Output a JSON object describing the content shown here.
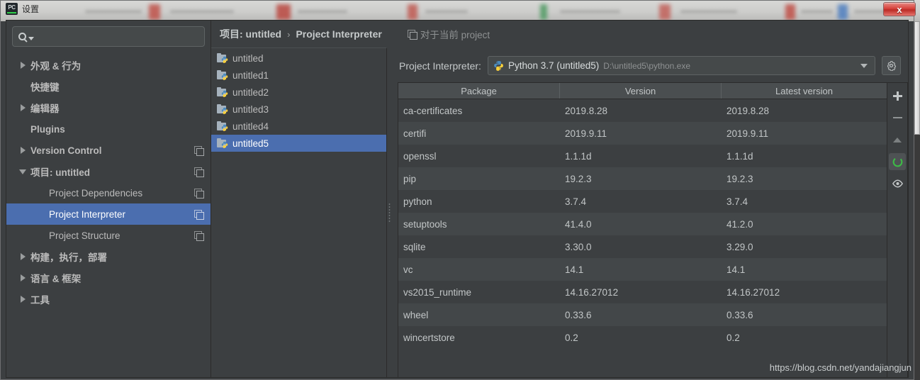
{
  "window": {
    "title": "设置",
    "logo_text": "PC",
    "close_label": "x"
  },
  "sidebar": {
    "search": {
      "value": "",
      "placeholder": ""
    },
    "items": [
      {
        "label": "外观 & 行为",
        "arrow": "right",
        "bold": true,
        "indent": false,
        "copy": false,
        "selected": false
      },
      {
        "label": "快捷键",
        "arrow": "none",
        "bold": true,
        "indent": false,
        "copy": false,
        "selected": false
      },
      {
        "label": "编辑器",
        "arrow": "right",
        "bold": true,
        "indent": false,
        "copy": false,
        "selected": false
      },
      {
        "label": "Plugins",
        "arrow": "none",
        "bold": true,
        "indent": false,
        "copy": false,
        "selected": false
      },
      {
        "label": "Version Control",
        "arrow": "right",
        "bold": true,
        "indent": false,
        "copy": true,
        "selected": false
      },
      {
        "label": "项目: untitled",
        "arrow": "down",
        "bold": true,
        "indent": false,
        "copy": true,
        "selected": false
      },
      {
        "label": "Project Dependencies",
        "arrow": "none",
        "bold": false,
        "indent": true,
        "copy": true,
        "selected": false
      },
      {
        "label": "Project Interpreter",
        "arrow": "none",
        "bold": false,
        "indent": true,
        "copy": true,
        "selected": true
      },
      {
        "label": "Project Structure",
        "arrow": "none",
        "bold": false,
        "indent": true,
        "copy": true,
        "selected": false
      },
      {
        "label": "构建，执行，部署",
        "arrow": "right",
        "bold": true,
        "indent": false,
        "copy": false,
        "selected": false
      },
      {
        "label": "语言 & 框架",
        "arrow": "right",
        "bold": true,
        "indent": false,
        "copy": false,
        "selected": false
      },
      {
        "label": "工具",
        "arrow": "right",
        "bold": true,
        "indent": false,
        "copy": false,
        "selected": false
      }
    ]
  },
  "breadcrumb": {
    "root": "项目: untitled",
    "separator": "›",
    "current": "Project Interpreter",
    "note": "对于当前 project"
  },
  "projects": [
    {
      "name": "untitled",
      "selected": false
    },
    {
      "name": "untitled1",
      "selected": false
    },
    {
      "name": "untitled2",
      "selected": false
    },
    {
      "name": "untitled3",
      "selected": false
    },
    {
      "name": "untitled4",
      "selected": false
    },
    {
      "name": "untitled5",
      "selected": true
    }
  ],
  "interpreter": {
    "label": "Project Interpreter:",
    "name": "Python 3.7 (untitled5)",
    "path": "D:\\untitled5\\python.exe",
    "gear_icon": "gear-icon",
    "caret_icon": "chevron-down-icon"
  },
  "packages_table": {
    "columns": [
      "Package",
      "Version",
      "Latest version"
    ],
    "rows": [
      {
        "package": "ca-certificates",
        "version": "2019.8.28",
        "latest": "2019.8.28"
      },
      {
        "package": "certifi",
        "version": "2019.9.11",
        "latest": "2019.9.11"
      },
      {
        "package": "openssl",
        "version": "1.1.1d",
        "latest": "1.1.1d"
      },
      {
        "package": "pip",
        "version": "19.2.3",
        "latest": "19.2.3"
      },
      {
        "package": "python",
        "version": "3.7.4",
        "latest": "3.7.4"
      },
      {
        "package": "setuptools",
        "version": "41.4.0",
        "latest": "41.2.0"
      },
      {
        "package": "sqlite",
        "version": "3.30.0",
        "latest": "3.29.0"
      },
      {
        "package": "vc",
        "version": "14.1",
        "latest": "14.1"
      },
      {
        "package": "vs2015_runtime",
        "version": "14.16.27012",
        "latest": "14.16.27012"
      },
      {
        "package": "wheel",
        "version": "0.33.6",
        "latest": "0.33.6"
      },
      {
        "package": "wincertstore",
        "version": "0.2",
        "latest": "0.2"
      }
    ]
  },
  "package_tools": [
    {
      "icon": "plus-icon",
      "name": "add-package-button",
      "active": false
    },
    {
      "icon": "minus-icon",
      "name": "remove-package-button",
      "active": false
    },
    {
      "icon": "up-arrow-icon",
      "name": "upgrade-package-button",
      "active": false
    },
    {
      "icon": "refresh-circle-icon",
      "name": "refresh-button",
      "active": true
    },
    {
      "icon": "eye-icon",
      "name": "show-early-releases-button",
      "active": false
    }
  ],
  "colors": {
    "accent_selection": "#4b6eaf",
    "panel_bg": "#3c3f41",
    "row_alt_bg": "#434749",
    "header_bg": "#4a4e50",
    "refresh_green": "#3dbb46",
    "close_red": "#d6423c",
    "text": "#bbbbbb"
  },
  "watermark": "https://blog.csdn.net/yandajiangjun"
}
